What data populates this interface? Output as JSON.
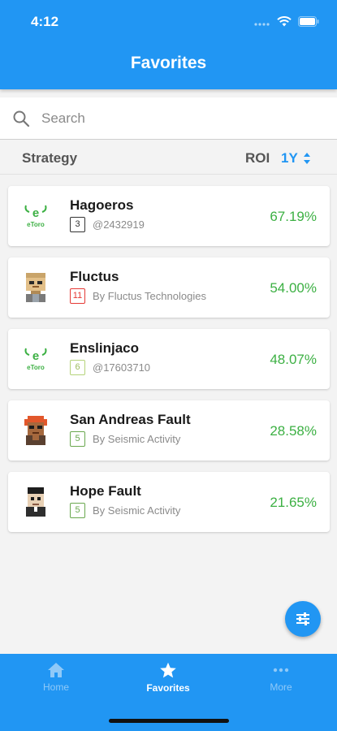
{
  "status_bar": {
    "time": "4:12"
  },
  "header": {
    "title": "Favorites"
  },
  "search": {
    "placeholder": "Search",
    "value": ""
  },
  "columns": {
    "strategy": "Strategy",
    "roi": "ROI",
    "period": "1Y"
  },
  "colors": {
    "accent": "#2196f3",
    "positive": "#3cb043"
  },
  "strategies": [
    {
      "name": "Hagoeros",
      "risk": "3",
      "risk_color": "#333333",
      "subtitle": "@2432919",
      "roi": "67.19%",
      "avatar": "etoro-logo",
      "avatar_text": "eToro"
    },
    {
      "name": "Fluctus",
      "risk": "11",
      "risk_color": "#e53935",
      "subtitle": "By Fluctus Technologies",
      "roi": "54.00%",
      "avatar": "pixel-avatar-robot"
    },
    {
      "name": "Enslinjaco",
      "risk": "6",
      "risk_color": "#b5d37a",
      "subtitle": "@17603710",
      "roi": "48.07%",
      "avatar": "etoro-logo",
      "avatar_text": "eToro"
    },
    {
      "name": "San Andreas Fault",
      "risk": "5",
      "risk_color": "#6aa84f",
      "subtitle": "By Seismic Activity",
      "roi": "28.58%",
      "avatar": "pixel-avatar-redhair"
    },
    {
      "name": "Hope Fault",
      "risk": "5",
      "risk_color": "#6aa84f",
      "subtitle": "By Seismic Activity",
      "roi": "21.65%",
      "avatar": "pixel-avatar-darkhair"
    }
  ],
  "nav": {
    "tabs": [
      {
        "label": "Home",
        "icon": "home-icon",
        "active": false
      },
      {
        "label": "Favorites",
        "icon": "star-icon",
        "active": true
      },
      {
        "label": "More",
        "icon": "more-dots-icon",
        "active": false
      }
    ]
  }
}
